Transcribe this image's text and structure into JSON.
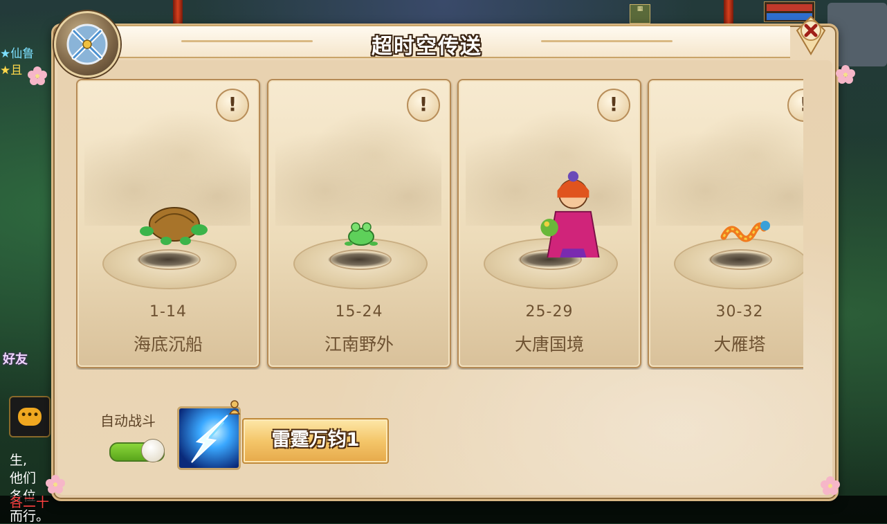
{
  "dialog": {
    "title": "超时空传送",
    "close_icon": "close-x-icon",
    "emblem_icon": "crossed-swords-emblem-icon"
  },
  "cards": [
    {
      "level": "1-14",
      "name": "海底沉船",
      "monster_icon": "turtle-icon",
      "info_label": "!"
    },
    {
      "level": "15-24",
      "name": "江南野外",
      "monster_icon": "frog-icon",
      "info_label": "!"
    },
    {
      "level": "25-29",
      "name": "大唐国境",
      "monster_icon": "flower-girl-icon",
      "info_label": "!"
    },
    {
      "level": "30-32",
      "name": "大雁塔",
      "monster_icon": "dragon-icon",
      "info_label": "!"
    }
  ],
  "auto_battle": {
    "label": "自动战斗",
    "enabled": true
  },
  "skill": {
    "label": "雷霆万钧1",
    "icon": "lightning-skill-icon"
  },
  "background": {
    "left_text": [
      "★仙鲁",
      "★且"
    ],
    "friend_label": "好友",
    "left_chat": [
      "生,",
      "他们",
      "各位"
    ],
    "announcement_prefix": "各二十",
    "announcement_tail": "而行。"
  },
  "colors": {
    "dialog_bg": "#ecd8b8",
    "card_text": "#6e5232",
    "toggle_on": "#6ab828",
    "skill_button": "#f4c66a"
  }
}
